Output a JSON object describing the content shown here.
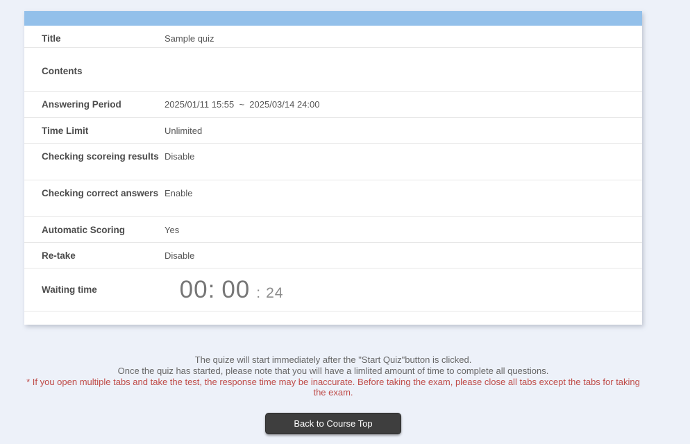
{
  "colors": {
    "page_background": "#edf1f9",
    "header_bar": "#93c0ea",
    "divider": "#e7e7e7",
    "warning_red": "#bf4b48",
    "button_background": "#3e3e3e"
  },
  "panel": {
    "rows": {
      "title": {
        "label": "Title",
        "value": "Sample quiz"
      },
      "contents": {
        "label": "Contents",
        "value": ""
      },
      "answering_period": {
        "label": "Answering Period",
        "value": "2025/01/11 15:55  ~  2025/03/14 24:00"
      },
      "time_limit": {
        "label": "Time Limit",
        "value": "Unlimited"
      },
      "checking_scoring_results": {
        "label": "Checking scoreing results",
        "value": "Disable"
      },
      "checking_correct_answers": {
        "label": "Checking correct answers",
        "value": "Enable"
      },
      "automatic_scoring": {
        "label": "Automatic Scoring",
        "value": "Yes"
      },
      "retake": {
        "label": "Re-take",
        "value": "Disable"
      },
      "waiting_time": {
        "label": "Waiting time",
        "hours": "00",
        "minutes": "00",
        "seconds": "24",
        "colon": ":"
      }
    }
  },
  "instructions": {
    "line1": "The quize will start immediately after the \"Start Quiz\"button is clicked.",
    "line2": "Once the quiz has started, please note that you will have a limlited amount of time to complete all questions.",
    "warning": "* If you open multiple tabs and take the test, the response time may be inaccurate. Before taking the exam, please close all tabs except the tabs for taking the exam."
  },
  "footer": {
    "back_button_label": "Back to Course Top"
  }
}
